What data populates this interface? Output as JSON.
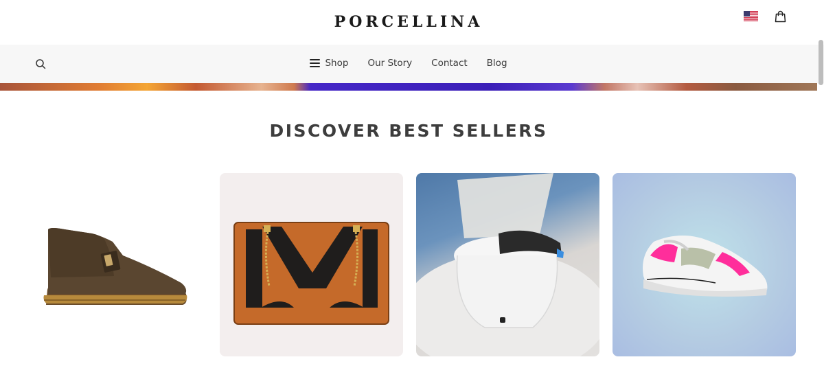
{
  "header": {
    "logo_text": "PORCELLINA",
    "flag_icon": "us-flag-icon",
    "cart_icon": "shopping-bag-icon"
  },
  "nav": {
    "search_icon": "search-icon",
    "items": [
      {
        "label": "Shop",
        "icon": "hamburger-menu-icon"
      },
      {
        "label": "Our Story"
      },
      {
        "label": "Contact"
      },
      {
        "label": "Blog"
      }
    ]
  },
  "main": {
    "section_title": "DISCOVER BEST SELLERS",
    "products": [
      {
        "image": "brown-suede-desert-boot"
      },
      {
        "image": "brown-black-chain-handbag"
      },
      {
        "image": "white-smart-toilet"
      },
      {
        "image": "white-pink-sneaker"
      }
    ]
  },
  "colors": {
    "background": "#ffffff",
    "navbar_bg": "#f7f7f7",
    "text_dark": "#3d3d3d",
    "logo": "#1a1a1a"
  }
}
